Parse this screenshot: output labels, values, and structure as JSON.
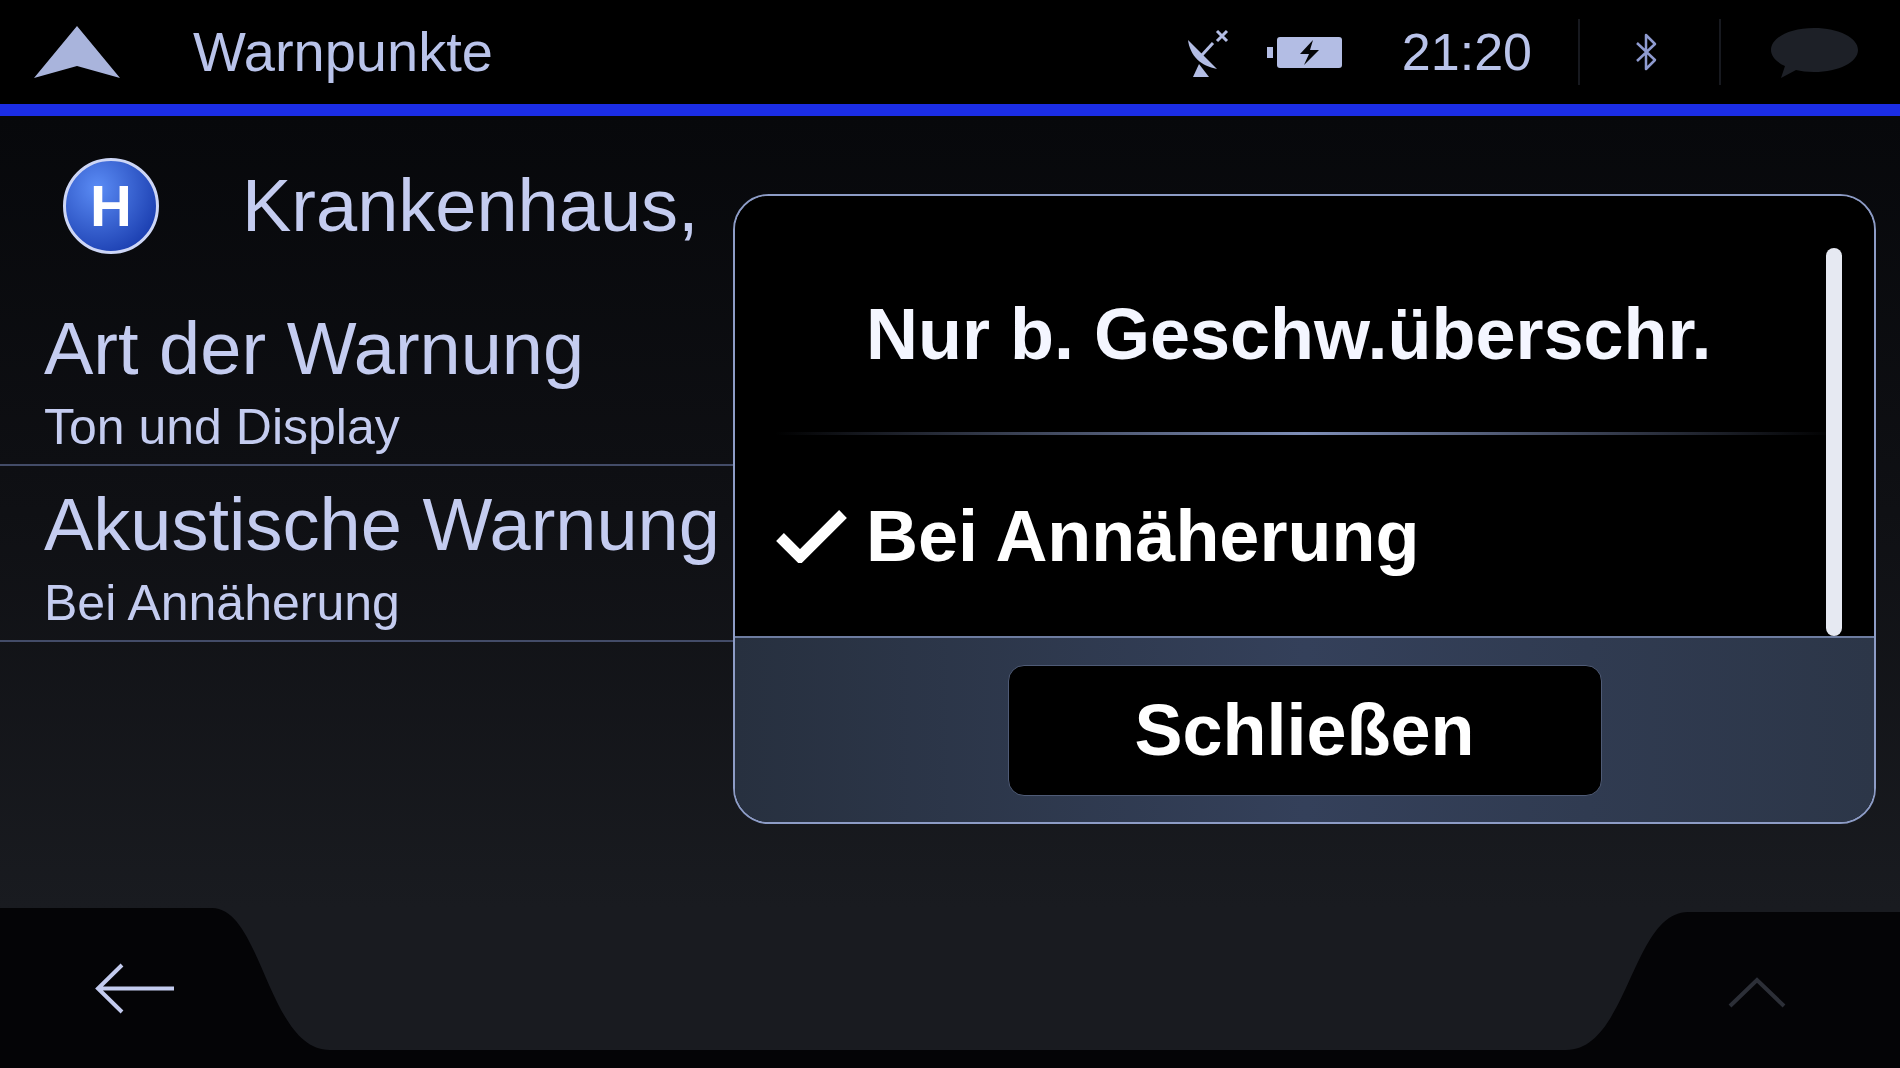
{
  "header": {
    "title": "Warnpunkte",
    "time": "21:20"
  },
  "poi": {
    "sign": "H",
    "name": "Krankenhaus,"
  },
  "settings": [
    {
      "label": "Art der Warnung",
      "value": "Ton und Display"
    },
    {
      "label": "Akustische Warnung",
      "value": "Bei Annäherung"
    }
  ],
  "dialog": {
    "options": [
      {
        "label": "Nur b. Geschw.überschr.",
        "selected": false
      },
      {
        "label": "Bei Annäherung",
        "selected": true
      }
    ],
    "close_button": "Schließen"
  }
}
